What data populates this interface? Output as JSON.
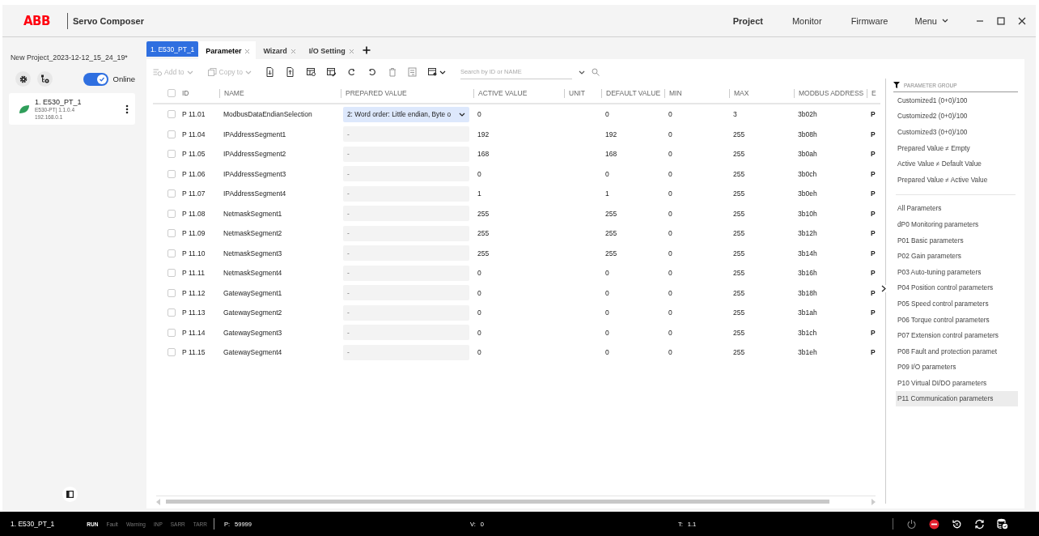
{
  "header": {
    "logo": "ABB",
    "app_title": "Servo Composer",
    "nav": [
      {
        "label": "Project",
        "selected": true
      },
      {
        "label": "Monitor",
        "selected": false
      },
      {
        "label": "Firmware",
        "selected": false
      }
    ],
    "menu": {
      "label": "Menu"
    }
  },
  "sidebar": {
    "project_name": "New Project_2023-12-12_15_24_19*",
    "online_toggle": {
      "label": "Online",
      "on": true
    },
    "device": {
      "name": "1. E530_PT_1",
      "model": "E530-PT| 1.1.0.4",
      "ip": "192.168.0.1"
    }
  },
  "device_chip": "1. E530_PT_1",
  "tabs": [
    {
      "label": "Parameter",
      "selected": true
    },
    {
      "label": "Wizard",
      "selected": false
    },
    {
      "label": "I/O Setting",
      "selected": false
    }
  ],
  "toolbar": {
    "add_to": {
      "label": "Add to",
      "disabled": true
    },
    "copy_to": {
      "label": "Copy to",
      "disabled": true
    },
    "search": {
      "placeholder": "Search by ID or NAME"
    }
  },
  "table": {
    "select_all_checked": false,
    "columns": [
      "ID",
      "NAME",
      "PREPARED VALUE",
      "ACTIVE VALUE",
      "UNIT",
      "DEFAULT VALUE",
      "MIN",
      "MAX",
      "MODBUS ADDRESS",
      "E"
    ],
    "rows": [
      {
        "checked": false,
        "kind": "dropdown",
        "cells": [
          "P 11.01",
          "ModbusDataEndianSelection",
          "2: Word order: Little endian, Byte o",
          "0",
          "",
          "0",
          "0",
          "3",
          "3b02h",
          "P"
        ]
      },
      {
        "checked": false,
        "kind": "input",
        "cells": [
          "P 11.04",
          "IPAddressSegment1",
          "-",
          "192",
          "",
          "192",
          "0",
          "255",
          "3b08h",
          "P"
        ]
      },
      {
        "checked": false,
        "kind": "input",
        "cells": [
          "P 11.05",
          "IPAddressSegment2",
          "-",
          "168",
          "",
          "168",
          "0",
          "255",
          "3b0ah",
          "P"
        ]
      },
      {
        "checked": false,
        "kind": "input",
        "cells": [
          "P 11.06",
          "IPAddressSegment3",
          "-",
          "0",
          "",
          "0",
          "0",
          "255",
          "3b0ch",
          "P"
        ]
      },
      {
        "checked": false,
        "kind": "input",
        "cells": [
          "P 11.07",
          "IPAddressSegment4",
          "-",
          "1",
          "",
          "1",
          "0",
          "255",
          "3b0eh",
          "P"
        ]
      },
      {
        "checked": false,
        "kind": "input",
        "cells": [
          "P 11.08",
          "NetmaskSegment1",
          "-",
          "255",
          "",
          "255",
          "0",
          "255",
          "3b10h",
          "P"
        ]
      },
      {
        "checked": false,
        "kind": "input",
        "cells": [
          "P 11.09",
          "NetmaskSegment2",
          "-",
          "255",
          "",
          "255",
          "0",
          "255",
          "3b12h",
          "P"
        ]
      },
      {
        "checked": false,
        "kind": "input",
        "cells": [
          "P 11.10",
          "NetmaskSegment3",
          "-",
          "255",
          "",
          "255",
          "0",
          "255",
          "3b14h",
          "P"
        ]
      },
      {
        "checked": false,
        "kind": "input",
        "cells": [
          "P 11.11",
          "NetmaskSegment4",
          "-",
          "0",
          "",
          "0",
          "0",
          "255",
          "3b16h",
          "P"
        ]
      },
      {
        "checked": false,
        "kind": "input",
        "cells": [
          "P 11.12",
          "GatewaySegment1",
          "-",
          "0",
          "",
          "0",
          "0",
          "255",
          "3b18h",
          "P"
        ]
      },
      {
        "checked": false,
        "kind": "input",
        "cells": [
          "P 11.13",
          "GatewaySegment2",
          "-",
          "0",
          "",
          "0",
          "0",
          "255",
          "3b1ah",
          "P"
        ]
      },
      {
        "checked": false,
        "kind": "input",
        "cells": [
          "P 11.14",
          "GatewaySegment3",
          "-",
          "0",
          "",
          "0",
          "0",
          "255",
          "3b1ch",
          "P"
        ]
      },
      {
        "checked": false,
        "kind": "input",
        "cells": [
          "P 11.15",
          "GatewaySegment4",
          "-",
          "0",
          "",
          "0",
          "0",
          "255",
          "3b1eh",
          "P"
        ]
      }
    ]
  },
  "parameter_group": {
    "title": "PARAMETER GROUP",
    "filters": [
      {
        "label": "Customized1 (0+0)/100",
        "selected": false
      },
      {
        "label": "Customized2 (0+0)/100",
        "selected": false
      },
      {
        "label": "Customized3 (0+0)/100",
        "selected": false
      },
      {
        "label": "Prepared Value ≠ Empty",
        "selected": false
      },
      {
        "label": "Active Value ≠ Default Value",
        "selected": false
      },
      {
        "label": "Prepared Value ≠ Active Value",
        "selected": false
      }
    ],
    "groups": [
      {
        "label": "All Parameters",
        "selected": false
      },
      {
        "label": "dP0 Monitoring parameters",
        "selected": false
      },
      {
        "label": "P01 Basic parameters",
        "selected": false
      },
      {
        "label": "P02 Gain parameters",
        "selected": false
      },
      {
        "label": "P03 Auto-tuning parameters",
        "selected": false
      },
      {
        "label": "P04 Position control parameters",
        "selected": false
      },
      {
        "label": "P05 Speed control parameters",
        "selected": false
      },
      {
        "label": "P06 Torque control parameters",
        "selected": false
      },
      {
        "label": "P07 Extension control parameters",
        "selected": false
      },
      {
        "label": "P08 Fault and protection paramet",
        "selected": false
      },
      {
        "label": "P09 I/O parameters",
        "selected": false
      },
      {
        "label": "P10 Virtual DI/DO parameters",
        "selected": false
      },
      {
        "label": "P11 Communication parameters",
        "selected": true
      }
    ]
  },
  "status_bar": {
    "device": "1. E530_PT_1",
    "flags": [
      {
        "label": "RUN",
        "active": true
      },
      {
        "label": "Fault",
        "active": false
      },
      {
        "label": "Warning",
        "active": false
      },
      {
        "label": "INP",
        "active": false
      },
      {
        "label": "SARR",
        "active": false
      },
      {
        "label": "TARR",
        "active": false
      }
    ],
    "readings": [
      {
        "label": "P:",
        "value": "59999"
      },
      {
        "label": "V:",
        "value": "0"
      },
      {
        "label": "T:",
        "value": "1.1"
      }
    ]
  }
}
